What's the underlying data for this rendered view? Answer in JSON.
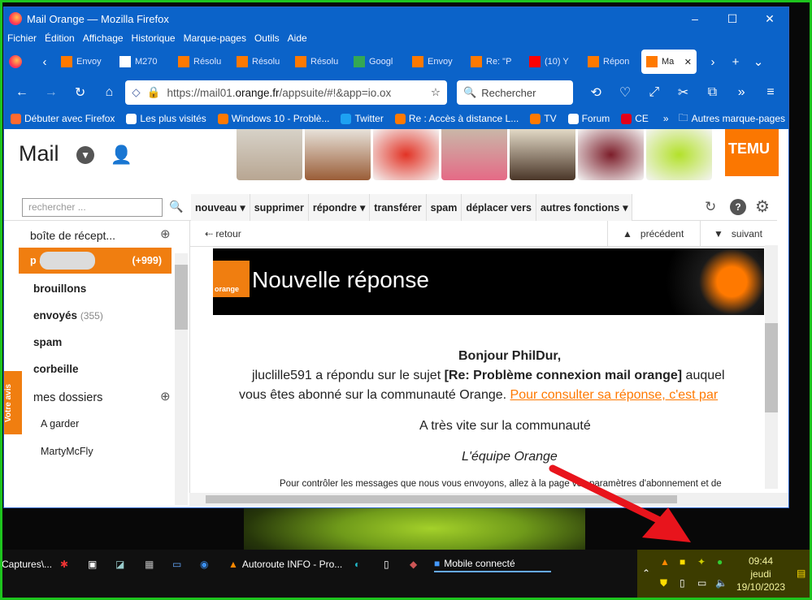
{
  "window": {
    "title": "Mail Orange — Mozilla Firefox",
    "min": "–",
    "max": "☐",
    "close": "✕"
  },
  "menu": [
    "Fichier",
    "Édition",
    "Affichage",
    "Historique",
    "Marque-pages",
    "Outils",
    "Aide"
  ],
  "tabs": [
    {
      "label": "Envoy",
      "icon": "orange-icon",
      "color": "#ff7900"
    },
    {
      "label": "M270",
      "icon": "wikipedia-icon",
      "color": "#ffffff"
    },
    {
      "label": "Résolu",
      "icon": "orange-icon",
      "color": "#ff7900"
    },
    {
      "label": "Résolu",
      "icon": "orange-icon",
      "color": "#ff7900"
    },
    {
      "label": "Résolu",
      "icon": "orange-icon",
      "color": "#ff7900"
    },
    {
      "label": "Googl",
      "icon": "maps-icon",
      "color": "#34a853"
    },
    {
      "label": "Envoy",
      "icon": "orange-icon",
      "color": "#ff7900"
    },
    {
      "label": "Re: \"P",
      "icon": "orange-icon",
      "color": "#ff7900"
    },
    {
      "label": "(10) Y",
      "icon": "youtube-icon",
      "color": "#ff0000"
    },
    {
      "label": "Répon",
      "icon": "orange-icon",
      "color": "#ff7900"
    },
    {
      "label": "Ma",
      "icon": "mail-icon",
      "color": "#ff7900",
      "active": true
    }
  ],
  "nav": {
    "url_prefix": "https://mail01.",
    "url_domain": "orange.fr",
    "url_suffix": "/appsuite/#!&app=io.ox",
    "search_placeholder": "Rechercher"
  },
  "bookmarks": [
    {
      "label": "Débuter avec Firefox",
      "icon": "firefox-icon",
      "color": "#ff6a30"
    },
    {
      "label": "Les plus visités",
      "icon": "gear-icon",
      "color": "#ffffff"
    },
    {
      "label": "Windows 10 - Problè...",
      "icon": "orange-icon",
      "color": "#ff7900"
    },
    {
      "label": "Twitter",
      "icon": "twitter-icon",
      "color": "#1da1f2"
    },
    {
      "label": "Re : Accès à distance L...",
      "icon": "orange-icon",
      "color": "#ff7900"
    },
    {
      "label": "TV",
      "icon": "orange-icon",
      "color": "#ff7900"
    },
    {
      "label": "Forum",
      "icon": "plane-icon",
      "color": "#ffffff"
    },
    {
      "label": "CE",
      "icon": "ce-icon",
      "color": "#e2001a"
    }
  ],
  "bookmarks_more": "Autres marque-pages",
  "mail": {
    "logo": "Mail",
    "search_placeholder": "rechercher ...",
    "temu": "TEMU",
    "tools": [
      "nouveau",
      "supprimer",
      "répondre",
      "transférer",
      "spam",
      "déplacer vers",
      "autres fonctions"
    ],
    "inbox": "boîte de récept...",
    "account": "p          @or...",
    "unread": "(+999)",
    "folders": [
      "brouillons",
      "envoyés",
      "spam",
      "corbeille"
    ],
    "sent_count": "(355)",
    "my_folders": "mes dossiers",
    "subfolders": [
      "A garder",
      "MartyMcFly"
    ],
    "votre_avis": "Votre avis",
    "back": "retour",
    "prev": "précédent",
    "next": "suivant"
  },
  "message": {
    "banner_title": "Nouvelle réponse",
    "brand": "orange",
    "greeting": "Bonjour PhilDur,",
    "line1a": "jluclille591 a répondu sur le sujet ",
    "line1b": "[Re: Problème connexion mail orange]",
    "line1c": " auquel",
    "line2a": "vous êtes abonné sur la communauté Orange. ",
    "line2link": "Pour consulter sa réponse, c'est par",
    "line3": "A très vite sur la communauté",
    "line4": "L'équipe Orange",
    "footer": "Pour contrôler les messages que nous vous envoyons, allez à la page vos paramètres d'abonnement et de"
  },
  "taskbar": {
    "items": [
      "Captures\\...",
      "Autoroute INFO - Pro...",
      "Mobile connecté"
    ],
    "time": "09:44",
    "day": "jeudi",
    "date": "19/10/2023"
  }
}
